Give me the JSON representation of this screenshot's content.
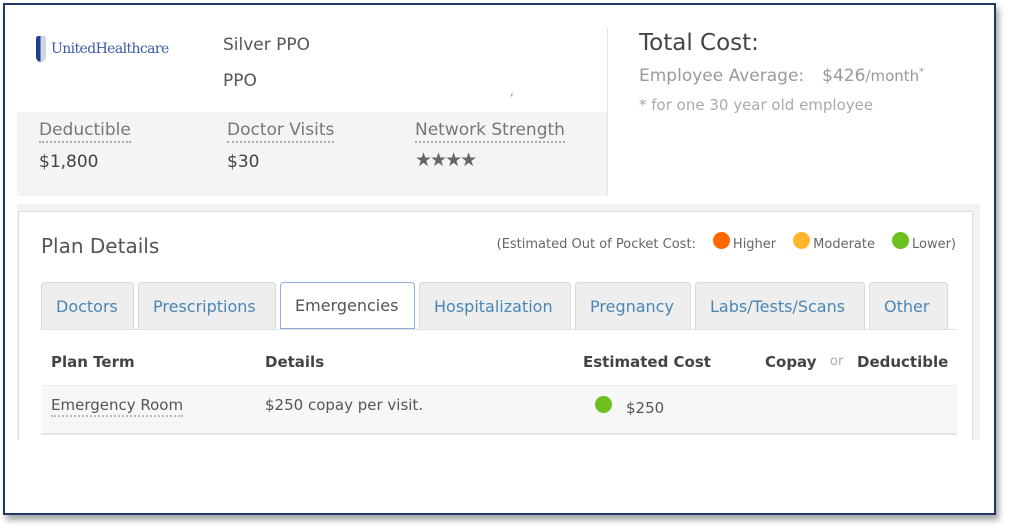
{
  "plan": {
    "carrier_logo_text": "UnitedHealthcare",
    "name": "Silver PPO",
    "type": "PPO",
    "stray_mark": ",",
    "stats": [
      {
        "label": "Deductible",
        "value": "$1,800"
      },
      {
        "label": "Doctor Visits",
        "value": "$30"
      },
      {
        "label": "Network Strength",
        "rating": 4,
        "rating_max": 4,
        "stars_text": "★★★★"
      }
    ]
  },
  "total_cost": {
    "title": "Total Cost:",
    "label": "Employee Average:",
    "amount": "$426",
    "period": "/month",
    "asterisk": "*",
    "note": "* for one 30 year old employee"
  },
  "plan_details": {
    "title": "Plan Details",
    "legend": {
      "prefix": "(Estimated Out of Pocket Cost:",
      "items": [
        {
          "label": "Higher",
          "color": "#ff6600"
        },
        {
          "label": "Moderate",
          "color": "#ffb52e"
        },
        {
          "label": "Lower)",
          "color": "#6ec01e"
        }
      ]
    },
    "tabs": [
      {
        "label": "Doctors",
        "active": false
      },
      {
        "label": "Prescriptions",
        "active": false
      },
      {
        "label": "Emergencies",
        "active": true
      },
      {
        "label": "Hospitalization",
        "active": false
      },
      {
        "label": "Pregnancy",
        "active": false
      },
      {
        "label": "Labs/Tests/Scans",
        "active": false
      },
      {
        "label": "Other",
        "active": false
      }
    ],
    "table": {
      "headers": {
        "plan_term": "Plan Term",
        "details": "Details",
        "estimated_cost": "Estimated Cost",
        "copay": "Copay",
        "or": "or",
        "deductible": "Deductible"
      },
      "rows": [
        {
          "term": "Emergency Room",
          "details": "$250 copay per visit.",
          "cost_level_color": "#6ec01e",
          "cost": "$250"
        }
      ]
    }
  }
}
